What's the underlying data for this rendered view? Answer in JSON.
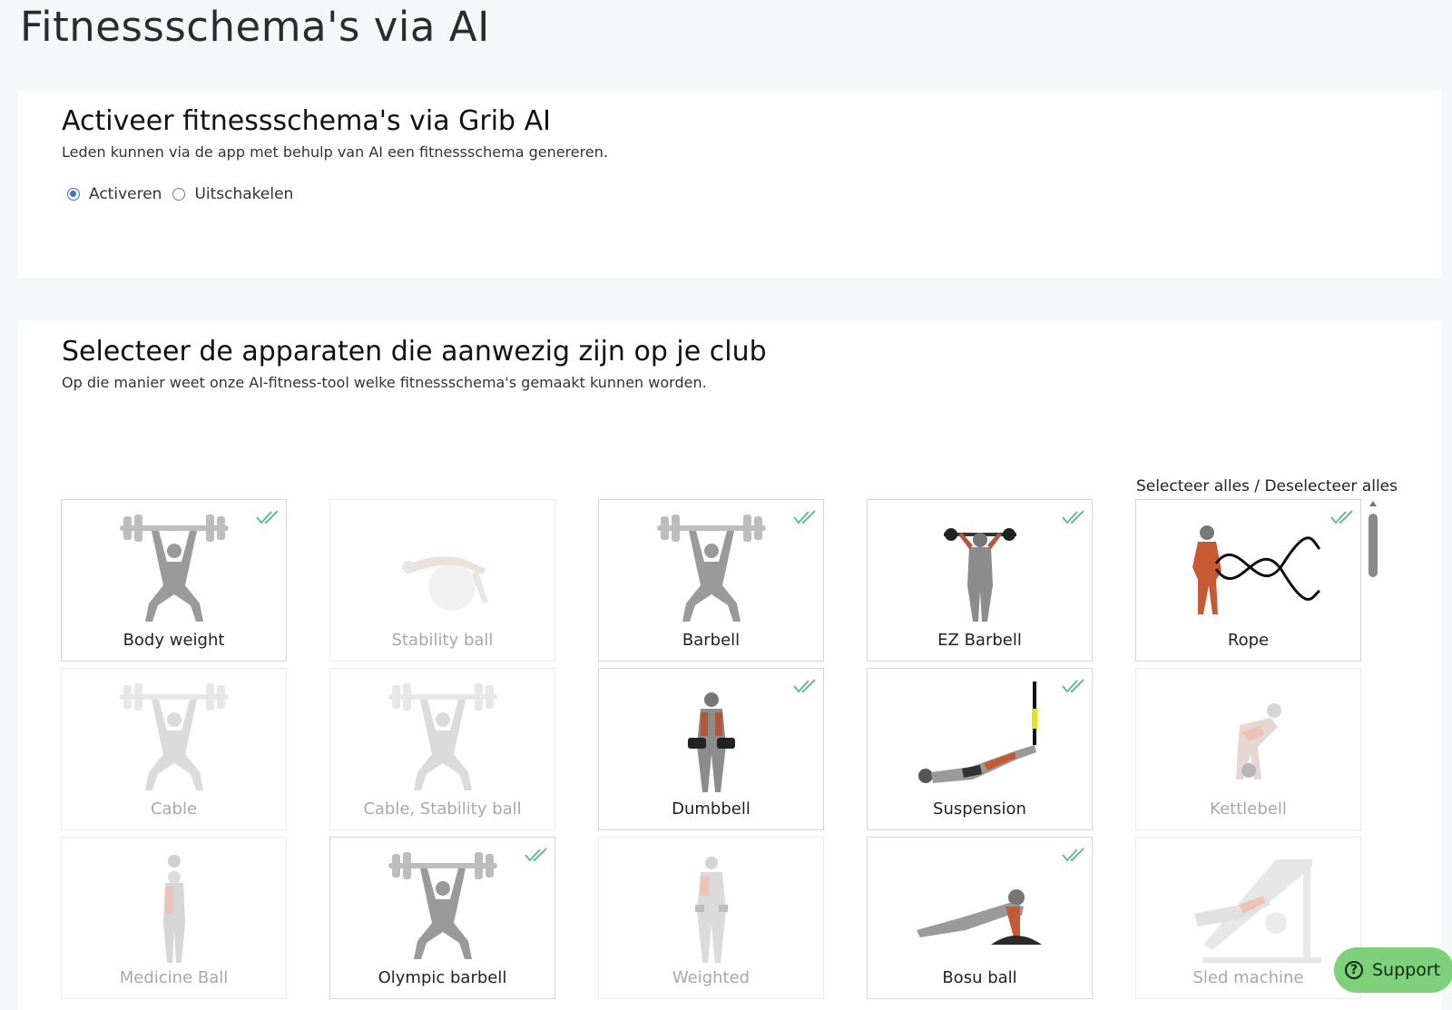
{
  "page_title": "Fitnessschema's via AI",
  "activation": {
    "title": "Activeer fitnessschema's via Grib AI",
    "description": "Leden kunnen via de app met behulp van AI een fitnessschema genereren.",
    "options": [
      {
        "label": "Activeren",
        "selected": true
      },
      {
        "label": "Uitschakelen",
        "selected": false
      }
    ]
  },
  "equipment": {
    "title": "Selecteer de apparaten die aanwezig zijn op je club",
    "description": "Op die manier weet onze AI-fitness-tool welke fitnessschema's gemaakt kunnen worden.",
    "select_all": "Selecteer alles",
    "separator": "/",
    "deselect_all": "Deselecteer alles",
    "items": [
      {
        "label": "Body weight",
        "selected": true,
        "icon": "lifter-icon"
      },
      {
        "label": "Stability ball",
        "selected": false,
        "icon": "stability-ball-icon"
      },
      {
        "label": "Barbell",
        "selected": true,
        "icon": "lifter-icon"
      },
      {
        "label": "EZ Barbell",
        "selected": true,
        "icon": "ez-barbell-icon"
      },
      {
        "label": "Rope",
        "selected": true,
        "icon": "battle-rope-icon"
      },
      {
        "label": "Cable",
        "selected": false,
        "icon": "lifter-icon"
      },
      {
        "label": "Cable, Stability ball",
        "selected": false,
        "icon": "lifter-icon"
      },
      {
        "label": "Dumbbell",
        "selected": true,
        "icon": "dumbbell-icon"
      },
      {
        "label": "Suspension",
        "selected": true,
        "icon": "suspension-icon"
      },
      {
        "label": "Kettlebell",
        "selected": false,
        "icon": "kettlebell-icon"
      },
      {
        "label": "Medicine Ball",
        "selected": false,
        "icon": "medicine-ball-icon"
      },
      {
        "label": "Olympic barbell",
        "selected": true,
        "icon": "lifter-icon"
      },
      {
        "label": "Weighted",
        "selected": false,
        "icon": "weighted-icon"
      },
      {
        "label": "Bosu ball",
        "selected": true,
        "icon": "bosu-ball-icon"
      },
      {
        "label": "Sled machine",
        "selected": false,
        "icon": "sled-machine-icon"
      }
    ]
  },
  "support": {
    "label": "Support",
    "icon": "help-icon"
  },
  "colors": {
    "check": "#5fbf8a",
    "radio": "#3b6fd6",
    "support_bg": "#7ed07a"
  }
}
